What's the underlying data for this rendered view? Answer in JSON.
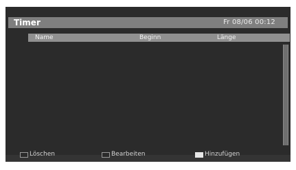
{
  "header": {
    "title": "Timer",
    "datetime": "Fr 08/06 00:12"
  },
  "table": {
    "columns": [
      "Name",
      "Beginn",
      "Länge"
    ],
    "rows": []
  },
  "footer": {
    "actions": [
      {
        "label": "Löschen",
        "swatch_color": "#2b2b2b"
      },
      {
        "label": "Bearbeiten",
        "swatch_color": "#2b2b2b"
      },
      {
        "label": "Hinzufügen",
        "swatch_color": "#e6e6e6"
      }
    ]
  }
}
